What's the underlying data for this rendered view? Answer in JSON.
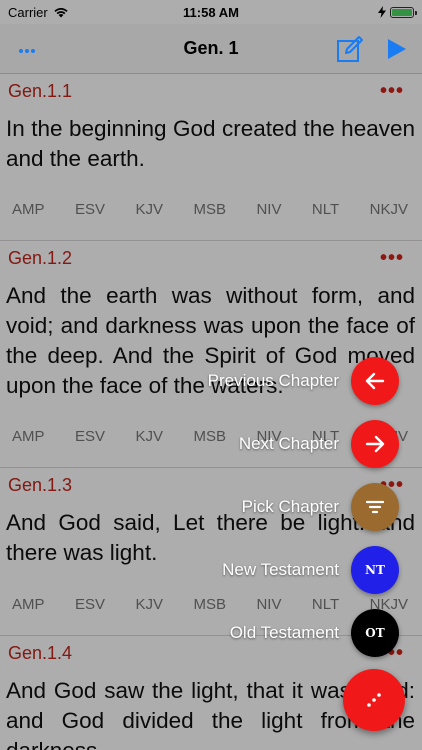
{
  "status": {
    "carrier": "Carrier",
    "time": "11:58 AM",
    "battery_level": 1.0
  },
  "nav": {
    "title": "Gen. 1",
    "left_icon": "more-dots-icon",
    "edit_icon": "compose-icon",
    "play_icon": "play-icon"
  },
  "versions": [
    "AMP",
    "ESV",
    "KJV",
    "MSB",
    "NIV",
    "NLT",
    "NKJV"
  ],
  "verses": [
    {
      "ref": "Gen.1.1",
      "text": "In the beginning God created the heaven and the earth."
    },
    {
      "ref": "Gen.1.2",
      "text": "And the earth was without form, and void; and darkness was upon the face of the deep. And the Spirit of God moved upon the face of the waters."
    },
    {
      "ref": "Gen.1.3",
      "text": "And God said, Let there be light: and there was light."
    },
    {
      "ref": "Gen.1.4",
      "text": "And God saw the light, that it was good: and God divided the light from the darkness."
    }
  ],
  "fab_menu": {
    "previous": "Previous Chapter",
    "next": "Next Chapter",
    "pick": "Pick Chapter",
    "new_testament": "New Testament",
    "new_testament_badge": "NT",
    "old_testament": "Old Testament",
    "old_testament_badge": "OT"
  },
  "colors": {
    "accent": "#1a7cf3",
    "verse_ref": "#c0261c",
    "fab_red": "#f01818",
    "fab_brown": "#9b6a2f",
    "fab_blue": "#2020e8",
    "fab_black": "#000000"
  }
}
